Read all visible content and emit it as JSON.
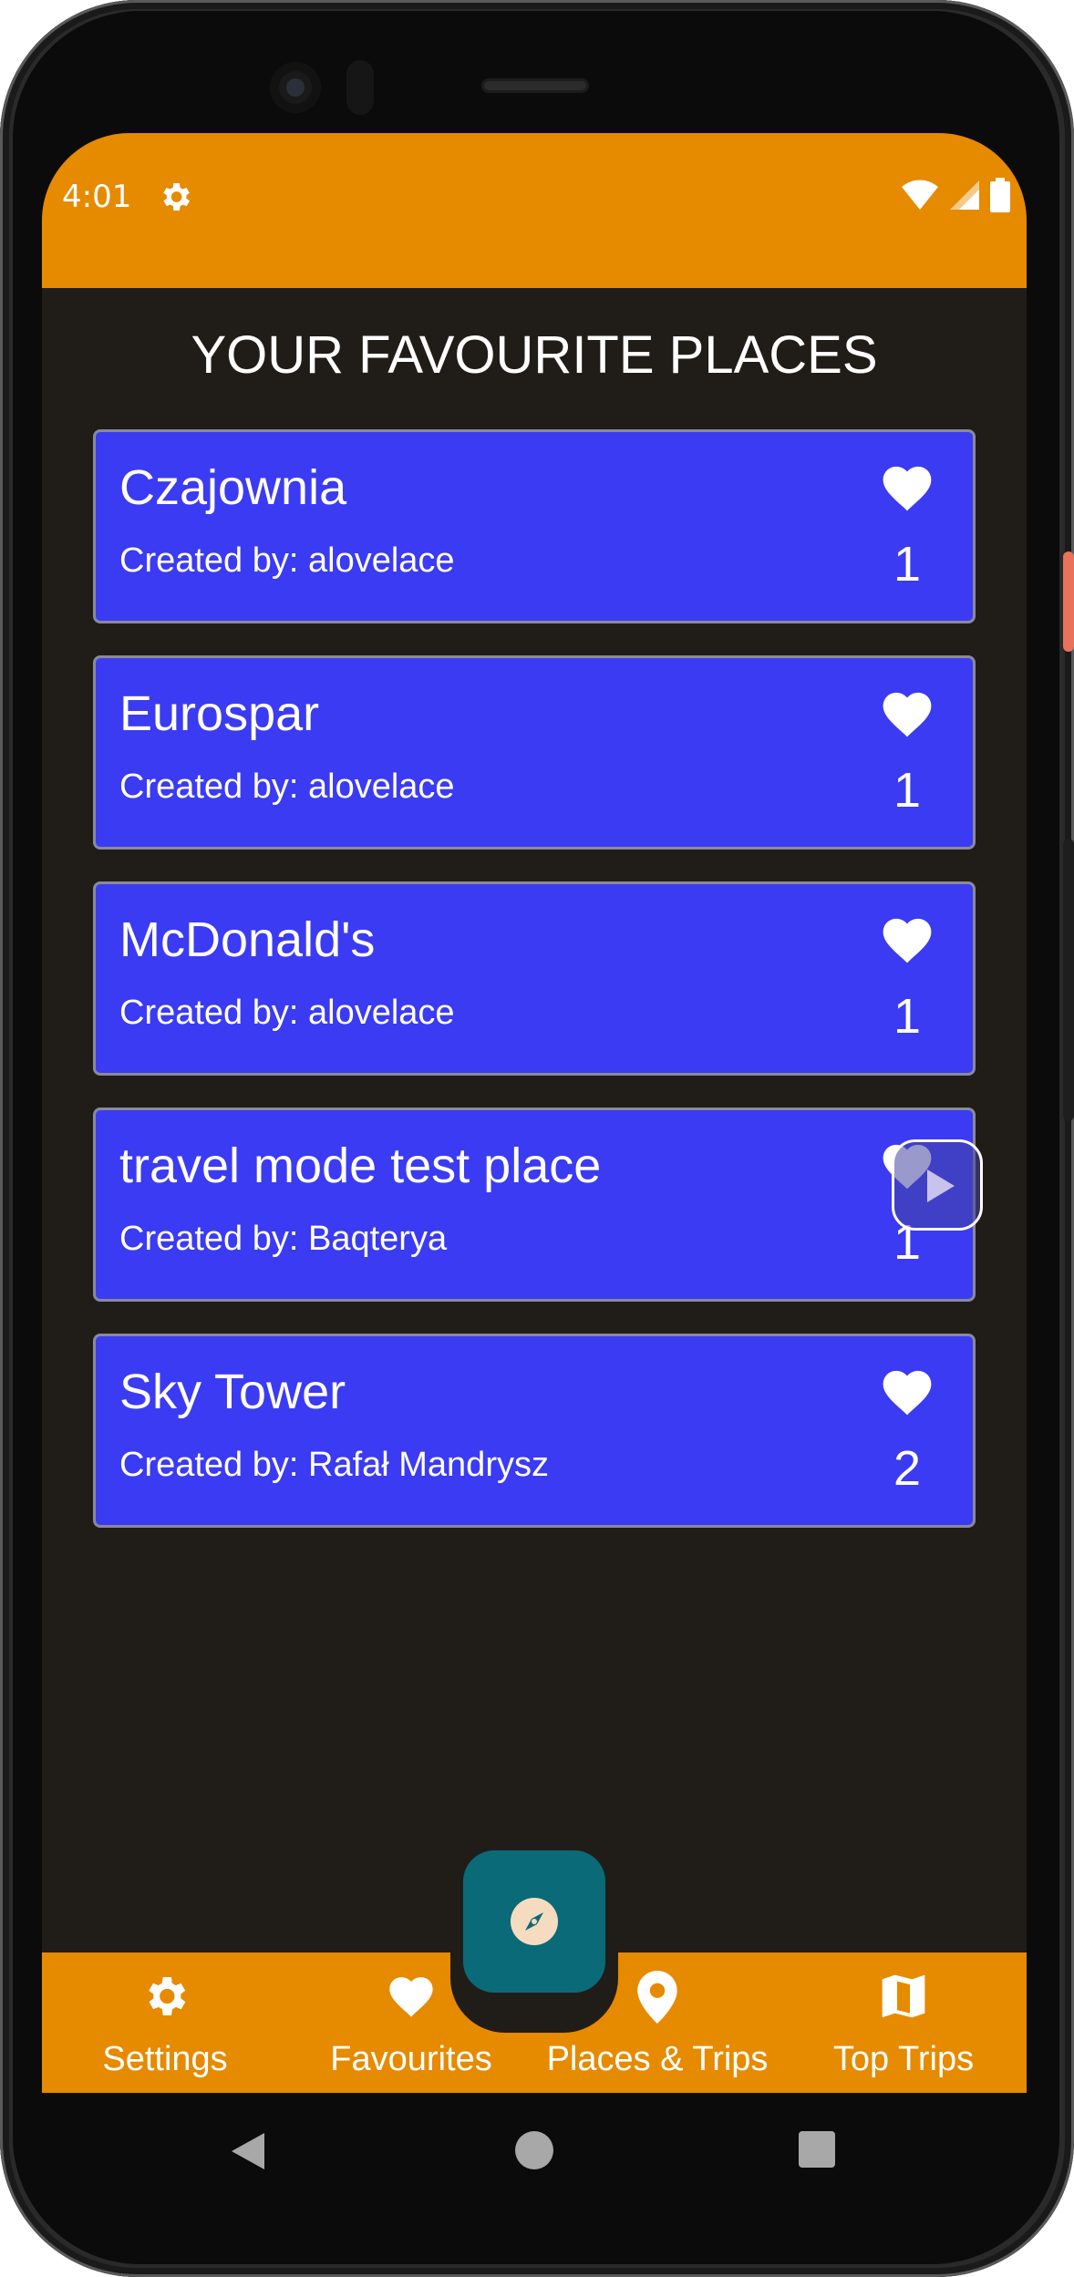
{
  "status_bar": {
    "time": "4:01"
  },
  "page": {
    "title": "YOUR FAVOURITE PLACES"
  },
  "places": [
    {
      "name": "Czajownia",
      "created_by": "Created by: alovelace",
      "likes": "1"
    },
    {
      "name": "Eurospar",
      "created_by": "Created by: alovelace",
      "likes": "1"
    },
    {
      "name": "McDonald's",
      "created_by": "Created by: alovelace",
      "likes": "1"
    },
    {
      "name": "travel mode test place",
      "created_by": "Created by: Baqterya",
      "likes": "1"
    },
    {
      "name": "Sky Tower",
      "created_by": "Created by: Rafał Mandrysz",
      "likes": "2"
    }
  ],
  "bottom_nav": {
    "settings": "Settings",
    "favourites": "Favourites",
    "places_trips": "Places & Trips",
    "top_trips": "Top Trips"
  },
  "colors": {
    "status_bar": "#e68a00",
    "background": "#201d19",
    "card": "#3b3bf3",
    "fab": "#0b6a78"
  },
  "icons": {
    "status": [
      "settings-gear-icon",
      "wifi-icon",
      "signal-icon",
      "battery-icon"
    ],
    "card": "heart-icon",
    "fab": "compass-icon",
    "floating": "play-icon"
  }
}
